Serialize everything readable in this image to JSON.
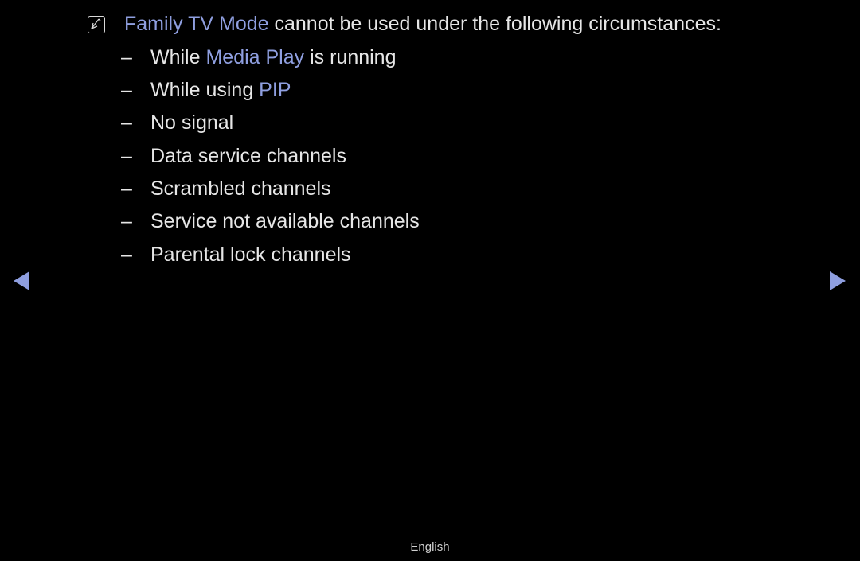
{
  "note": {
    "icon": "note-icon",
    "highlight": "Family TV Mode",
    "text": " cannot be used under the following circumstances:"
  },
  "items": [
    {
      "dash": "–",
      "pre": "While ",
      "hl": "Media Play",
      "post": " is running"
    },
    {
      "dash": "–",
      "pre": "While using ",
      "hl": "PIP",
      "post": ""
    },
    {
      "dash": "–",
      "pre": "No signal",
      "hl": "",
      "post": ""
    },
    {
      "dash": "–",
      "pre": "Data service channels",
      "hl": "",
      "post": ""
    },
    {
      "dash": "–",
      "pre": "Scrambled channels",
      "hl": "",
      "post": ""
    },
    {
      "dash": "–",
      "pre": "Service not available channels",
      "hl": "",
      "post": ""
    },
    {
      "dash": "–",
      "pre": "Parental lock channels",
      "hl": "",
      "post": ""
    }
  ],
  "nav": {
    "prev": "previous-page",
    "next": "next-page"
  },
  "footer": {
    "language": "English"
  },
  "colors": {
    "accent": "#8f9fe0",
    "text": "#e6e6e6",
    "background": "#000000"
  }
}
